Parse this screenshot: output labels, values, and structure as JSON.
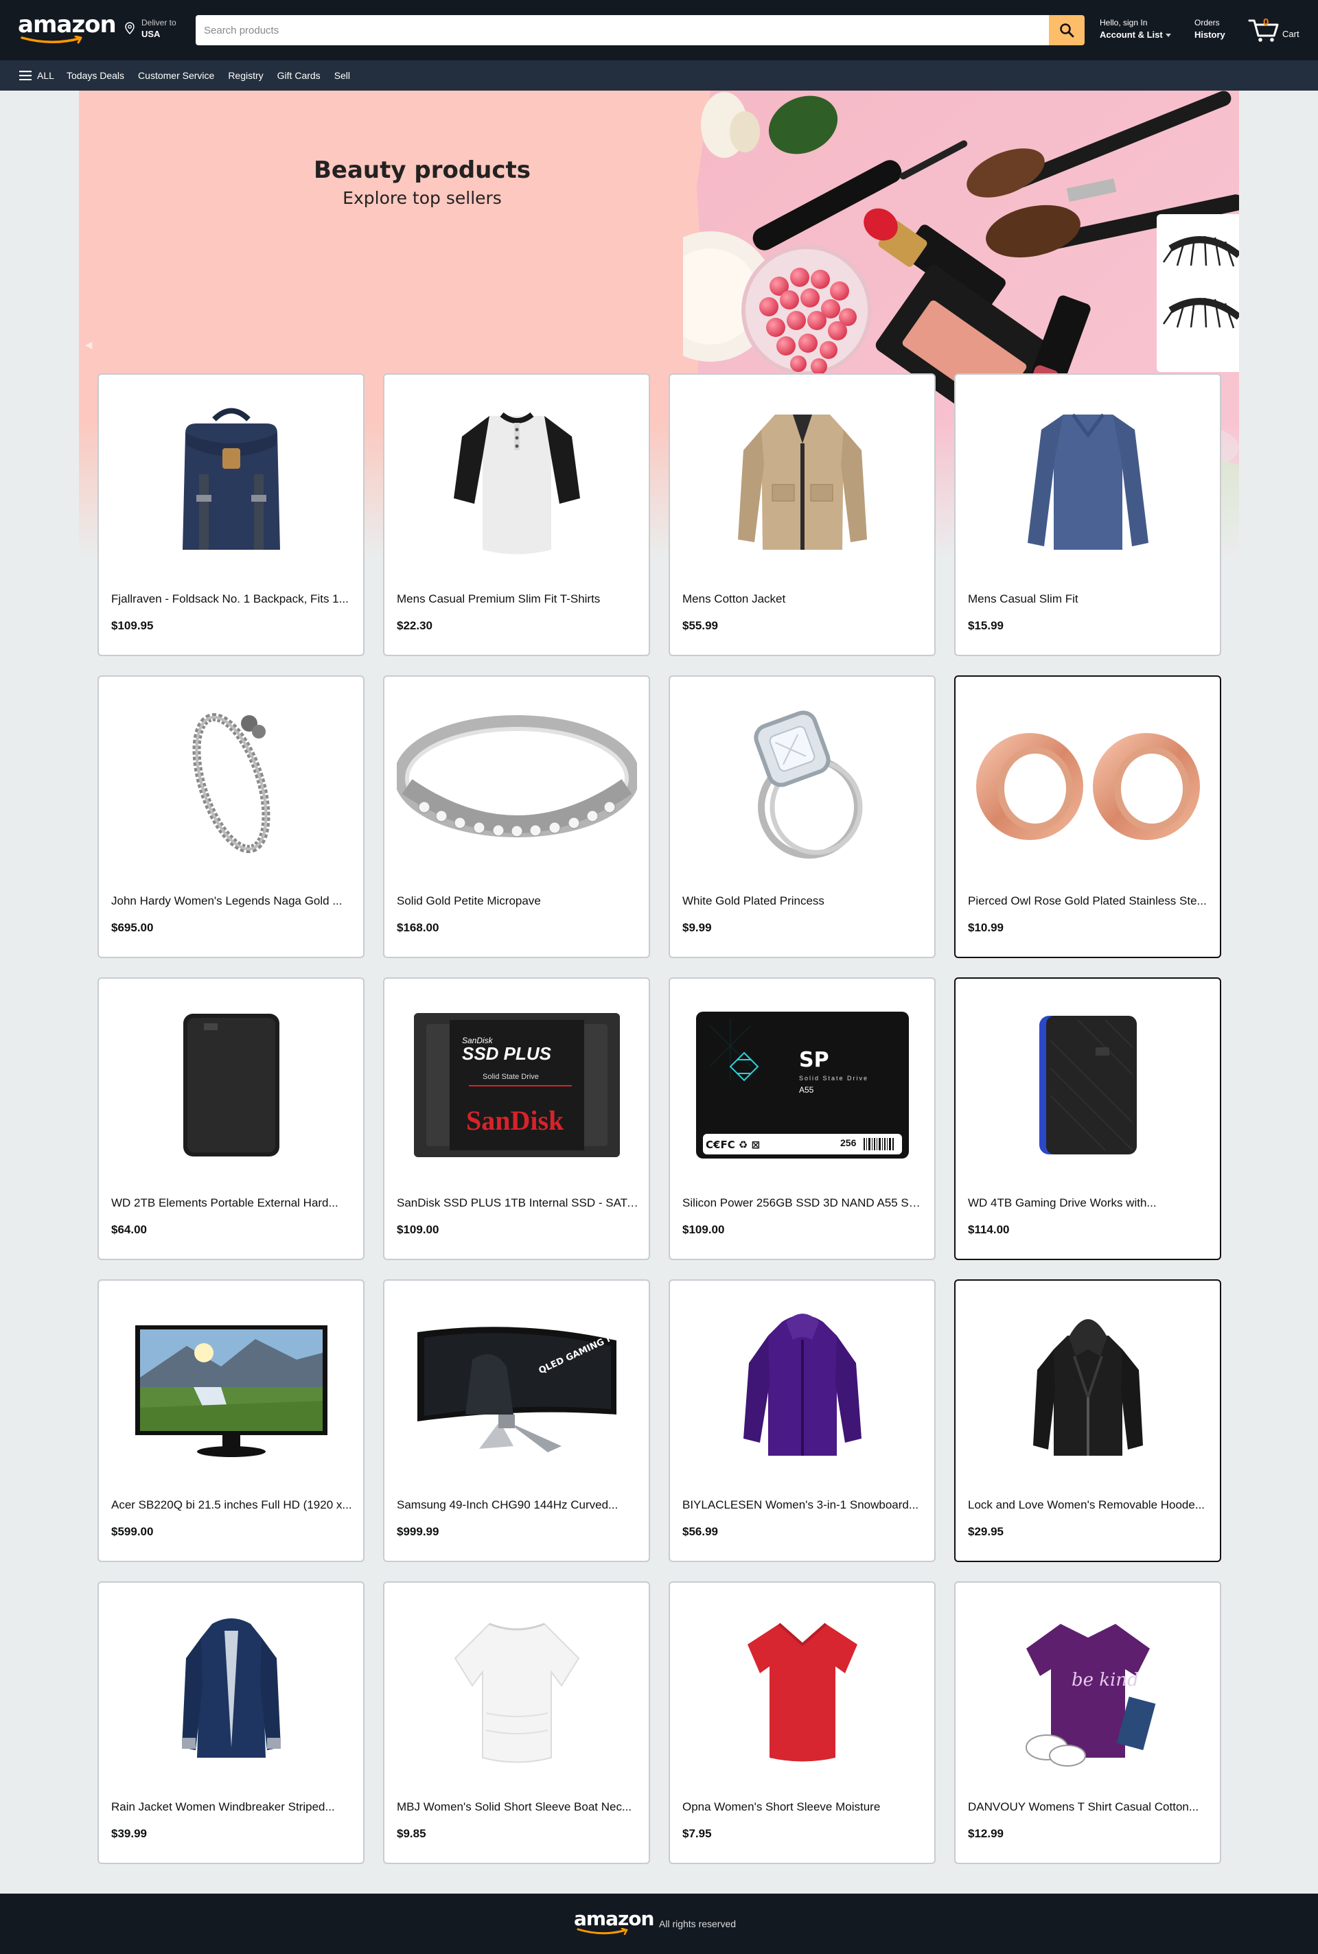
{
  "header": {
    "logo": "amazon",
    "deliver_line1": "Deliver to",
    "deliver_line2": "USA",
    "search_placeholder": "Search products",
    "account_line1": "Hello, sign In",
    "account_line2": "Account & List",
    "orders_line1": "Orders",
    "orders_line2": "History",
    "cart_count": "0",
    "cart_label": "Cart"
  },
  "nav": {
    "all_label": "ALL",
    "links": [
      "Todays Deals",
      "Customer Service",
      "Registry",
      "Gift Cards",
      "Sell"
    ]
  },
  "hero": {
    "title": "Beauty products",
    "subtitle": "Explore top sellers"
  },
  "products": [
    {
      "title": "Fjallraven - Foldsack No. 1 Backpack, Fits 1...",
      "price": "$109.95",
      "icon": "backpack-image"
    },
    {
      "title": "Mens Casual Premium Slim Fit T-Shirts",
      "price": "$22.30",
      "icon": "raglan-shirt-image"
    },
    {
      "title": "Mens Cotton Jacket",
      "price": "$55.99",
      "icon": "cotton-jacket-image"
    },
    {
      "title": "Mens Casual Slim Fit",
      "price": "$15.99",
      "icon": "long-sleeve-shirt-image"
    },
    {
      "title": "John Hardy Women's Legends Naga Gold ...",
      "price": "$695.00",
      "icon": "bracelet-image"
    },
    {
      "title": "Solid Gold Petite Micropave",
      "price": "$168.00",
      "icon": "ring-image"
    },
    {
      "title": "White Gold Plated Princess",
      "price": "$9.99",
      "icon": "diamond-ring-image"
    },
    {
      "title": "Pierced Owl Rose Gold Plated Stainless Ste...",
      "price": "$10.99",
      "icon": "ear-tunnels-image"
    },
    {
      "title": "WD 2TB Elements Portable External Hard...",
      "price": "$64.00",
      "icon": "external-drive-image"
    },
    {
      "title": "SanDisk SSD PLUS 1TB Internal SSD - SATA ...",
      "price": "$109.00",
      "icon": "sandisk-ssd-image"
    },
    {
      "title": "Silicon Power 256GB SSD 3D NAND A55 SL...",
      "price": "$109.00",
      "icon": "silicon-power-ssd-image"
    },
    {
      "title": "WD 4TB Gaming Drive Works with...",
      "price": "$114.00",
      "icon": "gaming-drive-image"
    },
    {
      "title": "Acer SB220Q bi 21.5 inches Full HD (1920 x...",
      "price": "$599.00",
      "icon": "monitor-image"
    },
    {
      "title": "Samsung 49-Inch CHG90 144Hz Curved...",
      "price": "$999.99",
      "icon": "curved-monitor-image"
    },
    {
      "title": "BIYLACLESEN Women's 3-in-1 Snowboard...",
      "price": "$56.99",
      "icon": "snowboard-jacket-image"
    },
    {
      "title": "Lock and Love Women's Removable Hoode...",
      "price": "$29.95",
      "icon": "leather-jacket-image"
    },
    {
      "title": "Rain Jacket Women Windbreaker Striped...",
      "price": "$39.99",
      "icon": "rain-jacket-image"
    },
    {
      "title": "MBJ Women's Solid Short Sleeve Boat Nec...",
      "price": "$9.85",
      "icon": "white-top-image"
    },
    {
      "title": "Opna Women's Short Sleeve Moisture",
      "price": "$7.95",
      "icon": "red-tshirt-image"
    },
    {
      "title": "DANVOUY Womens T Shirt Casual Cotton...",
      "price": "$12.99",
      "icon": "purple-tshirt-image"
    }
  ],
  "product_image_labels": {
    "sandisk_line1": "SanDisk",
    "sandisk_line2": "SSD PLUS",
    "sandisk_line3": "Solid State Drive",
    "sandisk_brand": "SanDisk",
    "sp_brand": "SP",
    "sp_line": "Solid State Drive",
    "sp_model": "A55",
    "sp_capacity": "256",
    "monitor_text": "QLED GAMING MONITOR",
    "tshirt_text": "be kind"
  },
  "footer": {
    "logo": "amazon",
    "rights": "All rights reserved"
  },
  "colors": {
    "header_bg": "#131921",
    "nav_bg": "#232f3e",
    "search_button": "#febd69",
    "cart_count": "#f08804",
    "hero_bg": "#fcc8bf",
    "page_bg": "#eaeded"
  }
}
